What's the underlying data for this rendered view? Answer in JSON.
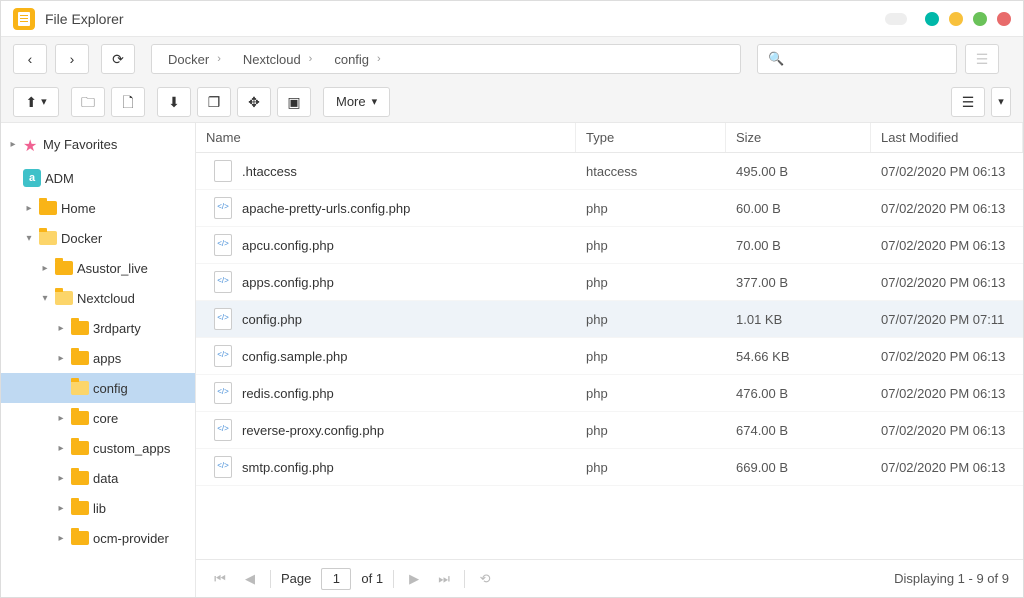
{
  "title": "File Explorer",
  "breadcrumb": [
    "Docker",
    "Nextcloud",
    "config"
  ],
  "search": {
    "placeholder": ""
  },
  "toolbar_more": "More",
  "sidebar": {
    "favorites": "My Favorites",
    "adm": "ADM",
    "items": [
      {
        "label": "Home",
        "depth": 1,
        "disc": "▸",
        "open": false
      },
      {
        "label": "Docker",
        "depth": 1,
        "disc": "▾",
        "open": true
      },
      {
        "label": "Asustor_live",
        "depth": 2,
        "disc": "▸",
        "open": false
      },
      {
        "label": "Nextcloud",
        "depth": 2,
        "disc": "▾",
        "open": true
      },
      {
        "label": "3rdparty",
        "depth": 3,
        "disc": "▸",
        "open": false
      },
      {
        "label": "apps",
        "depth": 3,
        "disc": "▸",
        "open": false
      },
      {
        "label": "config",
        "depth": 3,
        "disc": "",
        "open": true,
        "sel": true
      },
      {
        "label": "core",
        "depth": 3,
        "disc": "▸",
        "open": false
      },
      {
        "label": "custom_apps",
        "depth": 3,
        "disc": "▸",
        "open": false
      },
      {
        "label": "data",
        "depth": 3,
        "disc": "▸",
        "open": false
      },
      {
        "label": "lib",
        "depth": 3,
        "disc": "▸",
        "open": false
      },
      {
        "label": "ocm-provider",
        "depth": 3,
        "disc": "▸",
        "open": false
      }
    ]
  },
  "columns": {
    "name": "Name",
    "type": "Type",
    "size": "Size",
    "mod": "Last Modified"
  },
  "files": [
    {
      "name": ".htaccess",
      "type": "htaccess",
      "size": "495.00 B",
      "mod": "07/02/2020 PM 06:13",
      "icon": "plain"
    },
    {
      "name": "apache-pretty-urls.config.php",
      "type": "php",
      "size": "60.00 B",
      "mod": "07/02/2020 PM 06:13",
      "icon": "php"
    },
    {
      "name": "apcu.config.php",
      "type": "php",
      "size": "70.00 B",
      "mod": "07/02/2020 PM 06:13",
      "icon": "php"
    },
    {
      "name": "apps.config.php",
      "type": "php",
      "size": "377.00 B",
      "mod": "07/02/2020 PM 06:13",
      "icon": "php"
    },
    {
      "name": "config.php",
      "type": "php",
      "size": "1.01 KB",
      "mod": "07/07/2020 PM 07:11",
      "icon": "php",
      "hl": true
    },
    {
      "name": "config.sample.php",
      "type": "php",
      "size": "54.66 KB",
      "mod": "07/02/2020 PM 06:13",
      "icon": "php"
    },
    {
      "name": "redis.config.php",
      "type": "php",
      "size": "476.00 B",
      "mod": "07/02/2020 PM 06:13",
      "icon": "php"
    },
    {
      "name": "reverse-proxy.config.php",
      "type": "php",
      "size": "674.00 B",
      "mod": "07/02/2020 PM 06:13",
      "icon": "php"
    },
    {
      "name": "smtp.config.php",
      "type": "php",
      "size": "669.00 B",
      "mod": "07/02/2020 PM 06:13",
      "icon": "php"
    }
  ],
  "pagination": {
    "label": "Page",
    "current": "1",
    "of": "of 1",
    "display": "Displaying 1 - 9 of 9"
  }
}
